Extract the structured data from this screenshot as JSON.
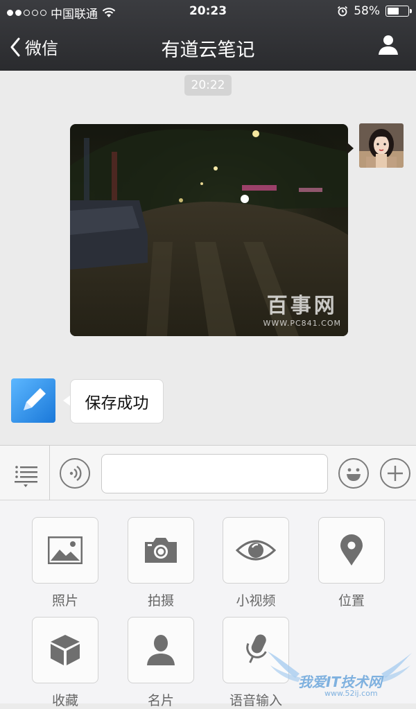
{
  "status_bar": {
    "carrier": "中国联通",
    "time": "20:23",
    "battery_percent": "58%",
    "battery_level": 0.58,
    "signal_bars_filled": 2,
    "signal_bars_total": 5
  },
  "nav": {
    "back_label": "微信",
    "title": "有道云笔记"
  },
  "chat": {
    "timestamp": "20:22",
    "photo_watermark": {
      "brand": "百事网",
      "url": "WWW.PC841.COM"
    },
    "reply_text": "保存成功"
  },
  "panel": {
    "items": [
      {
        "label": "照片",
        "icon": "photo-icon"
      },
      {
        "label": "拍摄",
        "icon": "camera-icon"
      },
      {
        "label": "小视频",
        "icon": "eye-icon"
      },
      {
        "label": "位置",
        "icon": "location-pin-icon"
      },
      {
        "label": "收藏",
        "icon": "cube-icon"
      },
      {
        "label": "名片",
        "icon": "person-card-icon"
      },
      {
        "label": "语音输入",
        "icon": "microphone-icon"
      }
    ]
  },
  "corner_watermark": {
    "text": "我爱IT技术网",
    "url": "www.52ij.com"
  },
  "colors": {
    "nav_bg": "#2a2b2e",
    "chat_bg": "#ebebeb",
    "panel_bg": "#f4f4f6",
    "icon_gray": "#7b7b7b"
  }
}
